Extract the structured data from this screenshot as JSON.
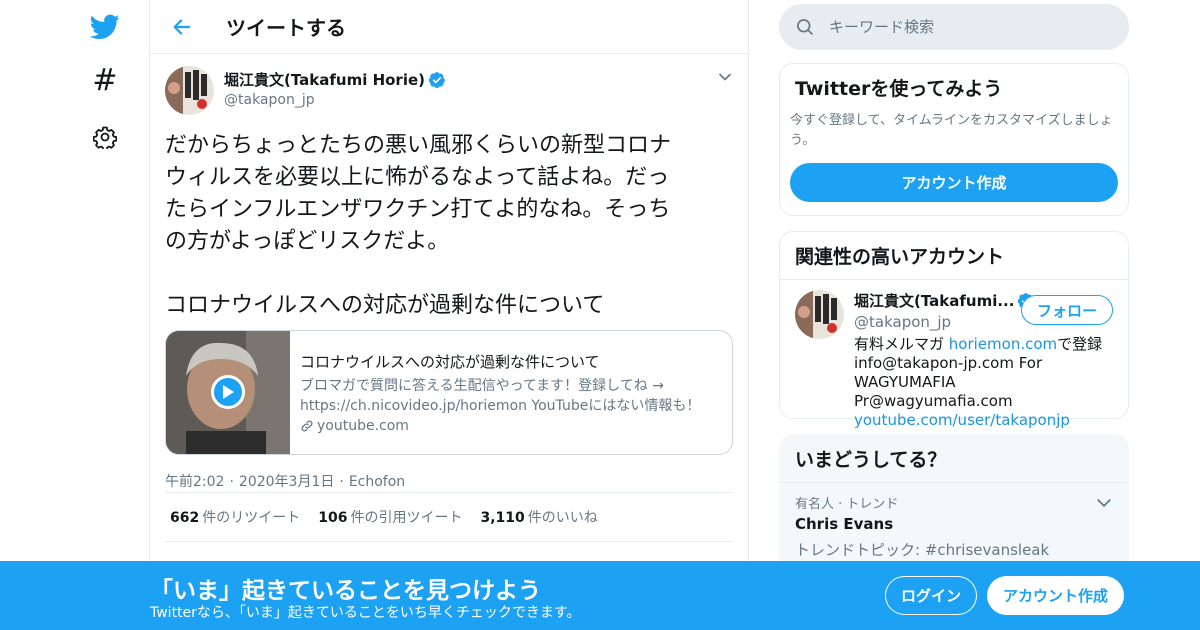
{
  "colors": {
    "accent": "#1da1f2",
    "text": "#14171a",
    "muted": "#657786",
    "link": "#1b95e0",
    "border": "#e6ecf0"
  },
  "nav": {
    "logo_icon": "twitter-bird-icon",
    "explore_icon": "hashtag-icon",
    "explore_symbol": "#",
    "settings_icon": "gear-icon"
  },
  "header": {
    "back_icon": "back-arrow-icon",
    "title": "ツイートする"
  },
  "tweet": {
    "author_name": "堀江貴文(Takafumi Horie)",
    "author_handle": "@takapon_jp",
    "text": "だからちょっとたちの悪い風邪くらいの新型コロナ\nウィルスを必要以上に怖がるなよって話よね。だっ\nたらインフルエンザワクチン打てよ的なね。そっち\nの方がよっぽどリスクだよ。\n\nコロナウイルスへの対応が過剰な件について",
    "card": {
      "title": "コロナウイルスへの対応が過剰な件について",
      "description": "ブロマガで質問に答える生配信やってます！登録してね → https://ch.nicovideo.jp/horiemon YouTubeにはない情報も！ホ...",
      "domain": "youtube.com"
    },
    "time": "午前2:02",
    "date": "2020年3月1日",
    "source": "Echofon",
    "stats": [
      {
        "num": "662",
        "label": "件のリツイート"
      },
      {
        "num": "106",
        "label": "件の引用ツイート"
      },
      {
        "num": "3,110",
        "label": "件のいいね"
      }
    ]
  },
  "search": {
    "placeholder": "キーワード検索"
  },
  "signup_panel": {
    "title": "Twitterを使ってみよう",
    "desc": "今すぐ登録して、タイムラインをカスタマイズしましょう。",
    "button": "アカウント作成"
  },
  "related": {
    "title": "関連性の高いアカウント",
    "name": "堀江貴文(Takafumi...",
    "handle": "@takapon_jp",
    "follow": "フォロー",
    "bio_prefix": "有料メルマガ ",
    "bio_link": "horiemon.com",
    "bio_mid": "で登録 info@takapon-jp.com For WAGYUMAFIA Pr@wagyumafia.com",
    "bio_link2": "youtube.com/user/takaponjp"
  },
  "trends": {
    "title": "いまどうしてる？",
    "items": [
      {
        "context": "有名人 · トレンド",
        "name": "Chris Evans",
        "topic": "トレンドトピック: #chrisevansleak"
      }
    ]
  },
  "banner": {
    "title": "「いま」起きていることを見つけよう",
    "subtitle": "Twitterなら、「いま」起きていることをいち早くチェックできます。",
    "login": "ログイン",
    "signup": "アカウント作成"
  }
}
